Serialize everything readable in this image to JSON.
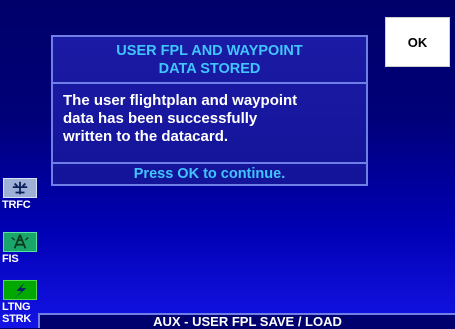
{
  "dialog": {
    "title_line1": "USER FPL AND WAYPOINT",
    "title_line2": "DATA STORED",
    "body_line1": "The user flightplan and waypoint",
    "body_line2": "data has been successfully",
    "body_line3": "written to the datacard.",
    "footer": "Press OK to continue."
  },
  "softkeys": {
    "ok_label": "OK"
  },
  "side_keys": [
    {
      "label": "TRFC",
      "icon": "traffic-icon"
    },
    {
      "label": "FIS",
      "icon": "fis-weather-icon"
    },
    {
      "label_line1": "LTNG",
      "label_line2": "STRK",
      "icon": "lightning-icon"
    }
  ],
  "bottom_bar": {
    "title": "AUX - USER FPL SAVE / LOAD"
  },
  "colors": {
    "accent_text": "#41c5ff",
    "border": "#6f7fe6",
    "background_top": "#00006a",
    "background_bottom": "#1414e6"
  }
}
